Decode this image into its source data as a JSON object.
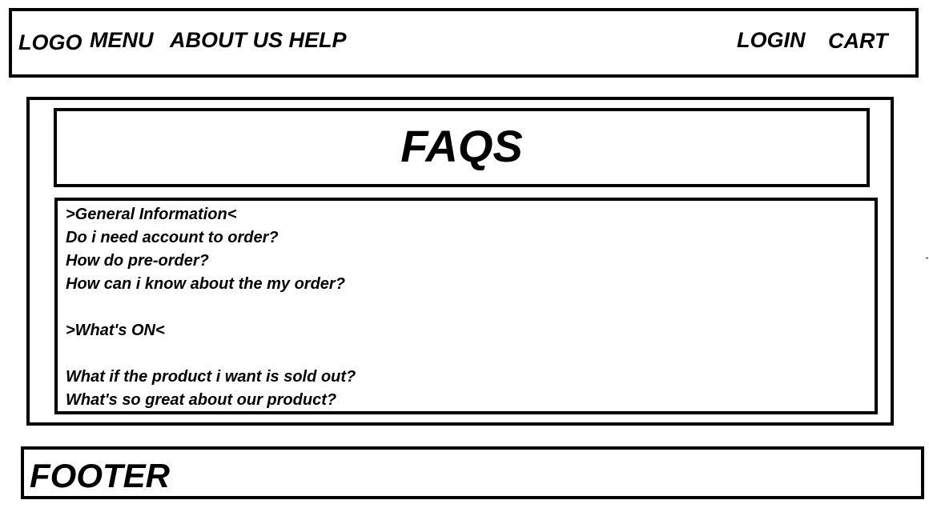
{
  "header": {
    "logo": "LOGO",
    "nav": {
      "menu": "MENU",
      "about_help": "ABOUT US HELP",
      "login": "LOGIN",
      "cart": "CART"
    }
  },
  "main": {
    "title": "FAQS",
    "faq": {
      "sections": [
        {
          "heading": ">General Information<",
          "questions": [
            "Do i need account to order?",
            "How do pre-order?",
            "How can i know about the my order?"
          ]
        },
        {
          "heading": ">What's ON<",
          "questions": [
            "What if the product i want is sold out?",
            "What's so great about our product?"
          ]
        }
      ]
    }
  },
  "footer": {
    "text": "FOOTER"
  },
  "colors": {
    "border": "#000000",
    "background": "#ffffff",
    "text": "#000000"
  }
}
